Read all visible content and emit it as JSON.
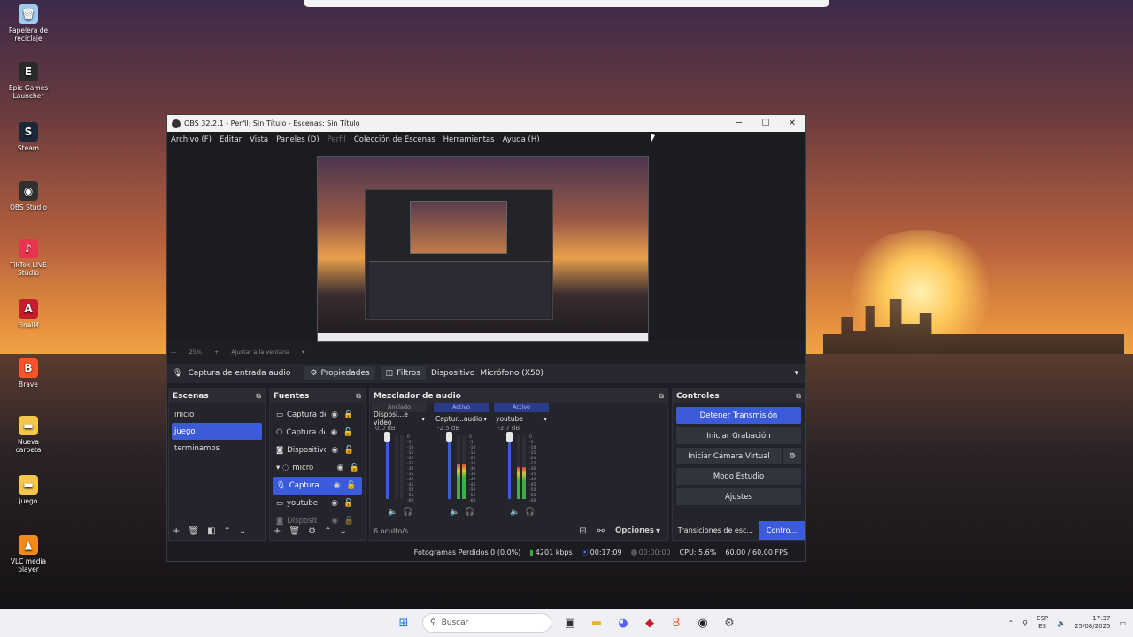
{
  "desktop": {
    "icons": [
      {
        "label": "Papelera de reciclaje",
        "icon": "recycle-bin-icon",
        "glyph": "🗑",
        "color": "#9ecbf0"
      },
      {
        "label": "Epic Games Launcher",
        "icon": "epic-games-icon",
        "glyph": "E",
        "color": "#2a2a2a"
      },
      {
        "label": "Steam",
        "icon": "steam-icon",
        "glyph": "S",
        "color": "#1b2838"
      },
      {
        "label": "OBS Studio",
        "icon": "obs-icon",
        "glyph": "◉",
        "color": "#303030"
      },
      {
        "label": "TikTok LIVE Studio",
        "icon": "tiktok-icon",
        "glyph": "♪",
        "color": "#e8354f"
      },
      {
        "label": "FinalM",
        "icon": "final-icon",
        "glyph": "A",
        "color": "#c41d2b"
      },
      {
        "label": "Brave",
        "icon": "brave-icon",
        "glyph": "B",
        "color": "#fb542b"
      },
      {
        "label": "Nueva carpeta",
        "icon": "folder-icon",
        "glyph": "▬",
        "color": "#f3c74a"
      },
      {
        "label": "juego",
        "icon": "folder-icon",
        "glyph": "▬",
        "color": "#f3c74a"
      },
      {
        "label": "VLC media player",
        "icon": "vlc-icon",
        "glyph": "▲",
        "color": "#f28b1b"
      }
    ]
  },
  "obs": {
    "title": "OBS 32.2.1 - Perfil: Sin Título - Escenas: Sin Título",
    "menu": [
      {
        "label": "Archivo (F)",
        "disabled": false
      },
      {
        "label": "Editar",
        "disabled": false
      },
      {
        "label": "Vista",
        "disabled": false
      },
      {
        "label": "Paneles (D)",
        "disabled": false
      },
      {
        "label": "Perfil",
        "disabled": true
      },
      {
        "label": "Colección de Escenas",
        "disabled": false
      },
      {
        "label": "Herramientas",
        "disabled": false
      },
      {
        "label": "Ayuda (H)",
        "disabled": false
      }
    ],
    "zoom": {
      "percent": "25%",
      "fit_label": "Ajustar a la ventana"
    },
    "source_toolbar": {
      "source_name": "Captura de entrada audio",
      "properties": "Propiedades",
      "filters": "Filtros",
      "device_label": "Dispositivo",
      "device_value": "Micrófono (X50)"
    },
    "scenes": {
      "title": "Escenas",
      "items": [
        "inicio",
        "juego",
        "terminamos"
      ],
      "selected": 1
    },
    "sources": {
      "title": "Fuentes",
      "items": [
        {
          "name": "Captura de",
          "icon": "monitor-icon",
          "glyph": "▭",
          "selected": false
        },
        {
          "name": "Captura de",
          "icon": "gamepad-icon",
          "glyph": "⎔",
          "selected": false
        },
        {
          "name": "Dispositivo",
          "icon": "camera-icon",
          "glyph": "◙",
          "selected": false
        },
        {
          "name": "micro",
          "icon": "group-icon",
          "glyph": "▾ ◌",
          "selected": false
        },
        {
          "name": "Captura",
          "icon": "microphone-icon",
          "glyph": "🎙",
          "selected": true
        },
        {
          "name": "youtube",
          "icon": "browser-icon",
          "glyph": "▭",
          "selected": false
        },
        {
          "name": "Disposit",
          "icon": "camera-icon",
          "glyph": "◙",
          "selected": false
        }
      ]
    },
    "mixer": {
      "title": "Mezclador de audio",
      "channels": [
        {
          "status": "Anclado",
          "active": false,
          "name": "Disposi...e video",
          "db": "0.0 dB",
          "level": 0.0
        },
        {
          "status": "Activo",
          "active": true,
          "name": "Captur...audio",
          "db": "-2.5 dB",
          "level": 0.55
        },
        {
          "status": "Activo",
          "active": true,
          "name": "youtube",
          "db": "-3.7 dB",
          "level": 0.5
        }
      ],
      "scale": [
        "0",
        "-5",
        "-10",
        "-15",
        "-20",
        "-25",
        "-30",
        "-35",
        "-40",
        "-45",
        "-50",
        "-55",
        "-60"
      ],
      "hidden_count": "6 oculto/s",
      "options": "Opciones"
    },
    "controls": {
      "title": "Controles",
      "stop_stream": "Detener Transmisión",
      "start_record": "Iniciar Grabación",
      "virtual_cam": "Iniciar Cámara Virtual",
      "studio_mode": "Modo Estudio",
      "settings": "Ajustes",
      "transitions_tab": "Transiciones de esc...",
      "controls_tab": "Contro..."
    },
    "status": {
      "dropped": "Fotogramas Perdidos 0 (0.0%)",
      "kbps": "4201 kbps",
      "stream_time": "00:17:09",
      "rec_time": "00:00:00",
      "cpu": "CPU: 5.6%",
      "fps": "60.00 / 60.00 FPS"
    }
  },
  "taskbar": {
    "search_placeholder": "Buscar",
    "lang_top": "ESP",
    "lang_bottom": "ES",
    "time": "17:37",
    "date": "25/08/2025",
    "apps": [
      {
        "icon": "start-icon",
        "glyph": "⊞",
        "color": "#1a73e8"
      },
      {
        "icon": "task-view-icon",
        "glyph": "▣",
        "color": "#333"
      },
      {
        "icon": "file-explorer-icon",
        "glyph": "▬",
        "color": "#e8b431"
      },
      {
        "icon": "discord-icon",
        "glyph": "◕",
        "color": "#5865f2"
      },
      {
        "icon": "app-red-icon",
        "glyph": "◆",
        "color": "#c41d2b"
      },
      {
        "icon": "brave-icon",
        "glyph": "B",
        "color": "#fb542b"
      },
      {
        "icon": "obs-icon",
        "glyph": "◉",
        "color": "#222"
      },
      {
        "icon": "settings-icon",
        "glyph": "⚙",
        "color": "#555"
      }
    ]
  }
}
